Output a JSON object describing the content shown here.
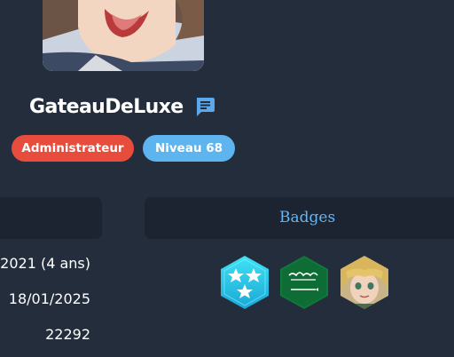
{
  "profile": {
    "username": "GateauDeLuxe",
    "role_badge": "Administrateur",
    "level_badge": "Niveau 68"
  },
  "tabs": {
    "badges_label": "Badges"
  },
  "stats": {
    "membership": "2021 (4 ans)",
    "last_seen": "18/01/2025",
    "count": "22292"
  },
  "badges": [
    {
      "icon": "stars-badge-icon"
    },
    {
      "icon": "flag-badge-icon"
    },
    {
      "icon": "character-badge-icon"
    }
  ],
  "colors": {
    "background": "#232d3b",
    "panel": "#1b2430",
    "admin": "#e84c3d",
    "level": "#5db4ee",
    "link": "#64b5f6"
  }
}
